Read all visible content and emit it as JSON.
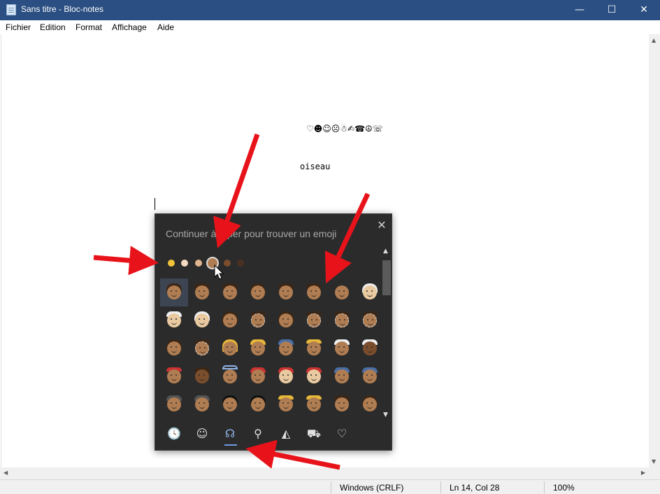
{
  "window": {
    "title": "Sans titre - Bloc-notes",
    "controls": {
      "minimize": "—",
      "maximize": "☐",
      "close": "✕"
    }
  },
  "menu": [
    "Fichier",
    "Edition",
    "Format",
    "Affichage",
    "Aide"
  ],
  "document": {
    "emoji_line": "♡☻☺☹☃✍☎☮☏",
    "word": "oiseau"
  },
  "emoji_panel": {
    "search_text": "Continuer à taper pour trouver un emoji",
    "close_icon": "✕",
    "scroll_up": "▲",
    "scroll_down": "▼",
    "skin_tones": [
      "#f2c33a",
      "#f4d9c1",
      "#e1b58f",
      "#b07d52",
      "#7a4e2d",
      "#4a3022"
    ],
    "selected_tone_index": 3,
    "tabs": [
      {
        "name": "recent-tab",
        "icon": "🕓"
      },
      {
        "name": "smileys-tab",
        "icon": "☺"
      },
      {
        "name": "people-tab",
        "icon": "☊"
      },
      {
        "name": "celebration-tab",
        "icon": "⚲"
      },
      {
        "name": "food-tab",
        "icon": "◭"
      },
      {
        "name": "transport-tab",
        "icon": "⛟"
      },
      {
        "name": "symbols-tab",
        "icon": "♡"
      }
    ],
    "active_tab_index": 2
  },
  "statusbar": {
    "line_ending": "Windows (CRLF)",
    "position": "Ln 14, Col 28",
    "zoom": "100%"
  },
  "colors": {
    "titlebar": "#2b4f82",
    "panel_bg": "#2b2b2b",
    "arrow": "#e8131a"
  }
}
